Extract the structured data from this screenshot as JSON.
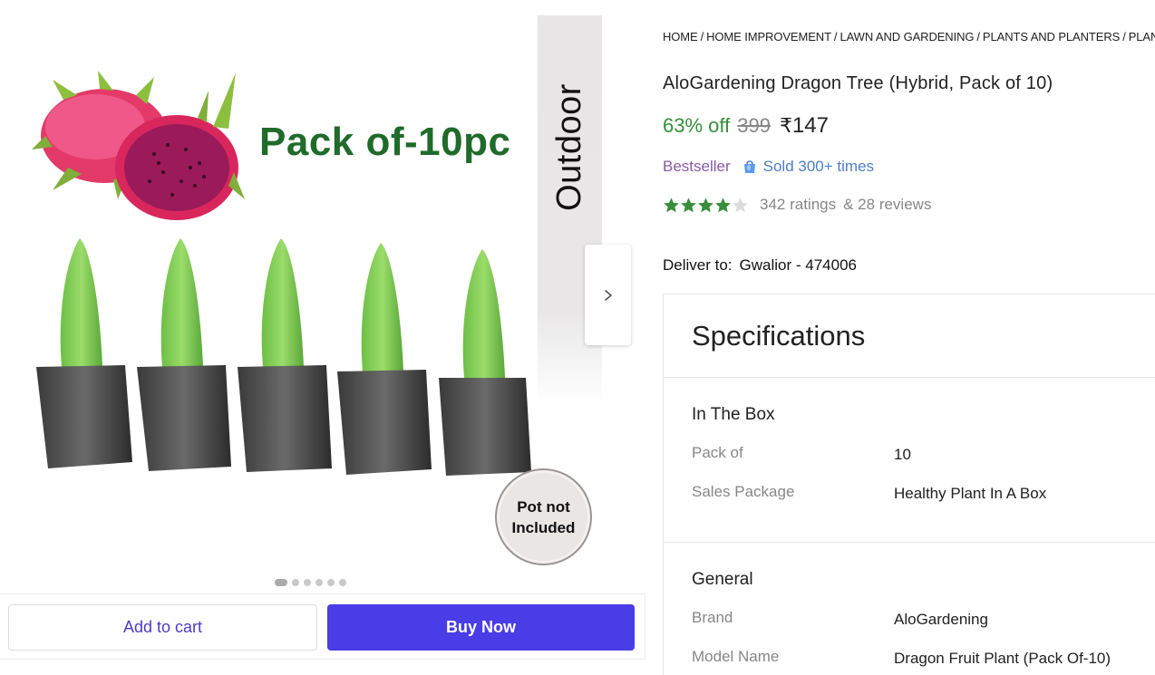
{
  "gallery": {
    "banner_text": "Pack of-10pc",
    "side_label": "Outdoor",
    "pot_badge": "Pot not Included",
    "next_icon": "chevron-right-icon",
    "dots": 6,
    "active_dot": 0
  },
  "actions": {
    "add_to_cart": "Add to cart",
    "buy_now": "Buy Now"
  },
  "breadcrumb": [
    "HOME",
    "HOME IMPROVEMENT",
    "LAWN AND GARDENING",
    "PLANTS AND PLANTERS",
    "PLAN"
  ],
  "product": {
    "title": "AloGardening Dragon Tree (Hybrid, Pack of 10)",
    "discount": "63% off",
    "mrp": "399",
    "currency": "₹",
    "price": "147",
    "bestseller": "Bestseller",
    "sold": "Sold 300+ times",
    "rating": 4,
    "rating_max": 5,
    "ratings_text": "342 ratings",
    "reviews_text": "& 28 reviews",
    "deliver_label": "Deliver to:",
    "deliver_location": "Gwalior - 474006"
  },
  "specifications": {
    "title": "Specifications",
    "groups": [
      {
        "name": "In The Box",
        "rows": [
          {
            "key": "Pack of",
            "value": "10"
          },
          {
            "key": "Sales Package",
            "value": "Healthy Plant In A Box"
          }
        ]
      },
      {
        "name": "General",
        "rows": [
          {
            "key": "Brand",
            "value": "AloGardening"
          },
          {
            "key": "Model Name",
            "value": "Dragon Fruit Plant (Pack Of-10)"
          }
        ]
      }
    ]
  },
  "colors": {
    "discount_green": "#388e3c",
    "star_green": "#388e3c",
    "buy_button": "#4a3ce6",
    "cart_text": "#4b3cc4",
    "banner_green": "#1f6b2a"
  }
}
